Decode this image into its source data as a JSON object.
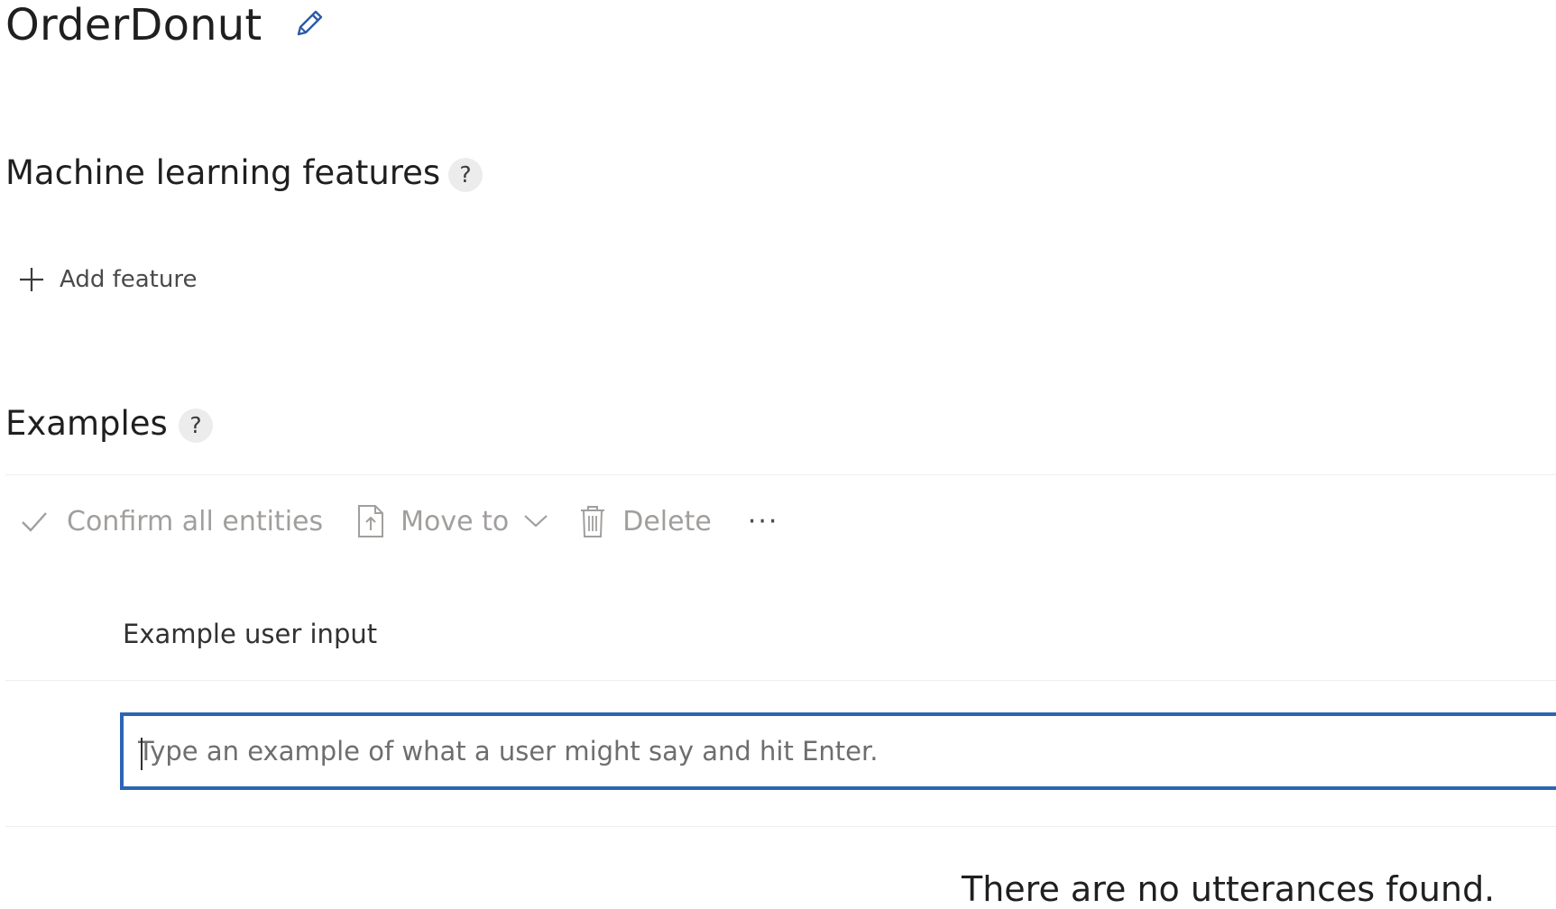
{
  "intent": {
    "name": "OrderDonut",
    "edit_icon": "pencil-icon"
  },
  "features_section": {
    "title": "Machine learning features",
    "help_label": "?",
    "add_feature_label": "Add feature",
    "add_icon": "plus-icon"
  },
  "examples_section": {
    "title": "Examples",
    "help_label": "?",
    "toolbar": {
      "confirm_label": "Confirm all entities",
      "move_label": "Move to",
      "delete_label": "Delete",
      "more_label": "···",
      "icons": [
        "checkmark-icon",
        "move-document-icon",
        "chevron-down-icon",
        "trash-icon"
      ],
      "disabled_color": "#a19f9d"
    },
    "column_header": "Example user input",
    "input": {
      "value": "",
      "placeholder": "Type an example of what a user might say and hit Enter.",
      "focus_color": "#2b65b6"
    },
    "empty_message": "There are no utterances found."
  }
}
